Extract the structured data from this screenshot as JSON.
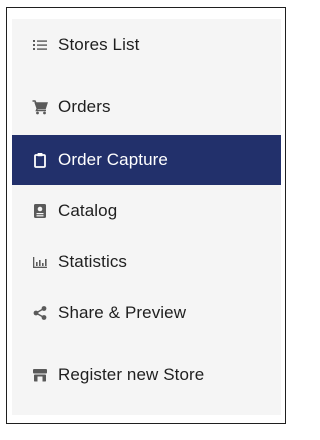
{
  "sidebar": {
    "accent_color": "#22306b",
    "icon_color": "#5a5a5a",
    "items": [
      {
        "label": "Stores List",
        "icon": "list-icon",
        "active": false
      },
      {
        "label": "Orders",
        "icon": "cart-icon",
        "active": false
      },
      {
        "label": "Order Capture",
        "icon": "clipboard-icon",
        "active": true
      },
      {
        "label": "Catalog",
        "icon": "catalog-book-icon",
        "active": false
      },
      {
        "label": "Statistics",
        "icon": "bar-chart-icon",
        "active": false
      },
      {
        "label": "Share & Preview",
        "icon": "share-icon",
        "active": false
      },
      {
        "label": "Register new Store",
        "icon": "store-icon",
        "active": false
      }
    ]
  }
}
